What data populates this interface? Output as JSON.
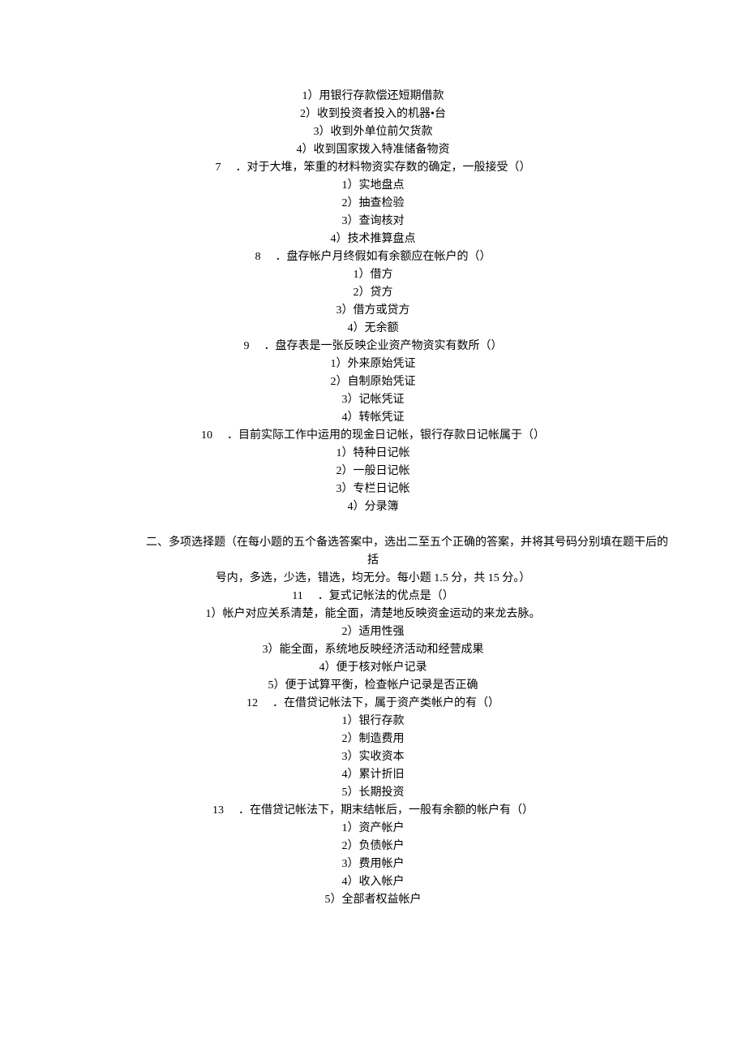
{
  "q6": {
    "options": [
      "1）用银行存款偿还短期借款",
      "2）收到投资者投入的机器•台",
      "3）收到外单位前欠货款",
      "4）收到国家拨入特准储备物资"
    ]
  },
  "q7": {
    "num": "7",
    "stem": "．对于大堆，笨重的材料物资实存数的确定，一般接受（）",
    "options": [
      "1）实地盘点",
      "2）抽查检验",
      "3）查询核对",
      "4）技术推算盘点"
    ]
  },
  "q8": {
    "num": "8",
    "stem": "．盘存帐户月终假如有余额应在帐户的（）",
    "options": [
      "1）借方",
      "2）贷方",
      "3）借方或贷方",
      "4）无余额"
    ]
  },
  "q9": {
    "num": "9",
    "stem": "．盘存表是一张反映企业资产物资实有数所（）",
    "options": [
      "1）外来原始凭证",
      "2）自制原始凭证",
      "3）记帐凭证",
      "4）转帐凭证"
    ]
  },
  "q10": {
    "num": "10",
    "stem": "．目前实际工作中运用的现金日记帐，银行存款日记帐属于（）",
    "options": [
      "1）特种日记帐",
      "2）一般日记帐",
      "3）专栏日记帐",
      "4）分录簿"
    ]
  },
  "section2": {
    "title_line1": "二、多项选择题（在每小题的五个备选答案中，选出二至五个正确的答案，并将其号码分别填在题干后的",
    "title_line2": "括",
    "instruction": "号内，多选，少选，错选，均无分。每小题 1.5 分，共 15 分。）"
  },
  "q11": {
    "num": "11",
    "stem": "．复式记帐法的优点是（）",
    "options": [
      "1）帐户对应关系清楚，能全面，清楚地反映资金运动的来龙去脉。",
      "2）适用性强",
      "3）能全面，系统地反映经济活动和经营成果",
      "4）便于核对帐户记录",
      "5）便于试算平衡，检查帐户记录是否正确"
    ]
  },
  "q12": {
    "num": "12",
    "stem": "．在借贷记帐法下，属于资产类帐户的有（）",
    "options": [
      "1）银行存款",
      "2）制造费用",
      "3）实收资本",
      "4）累计折旧",
      "5）长期投资"
    ]
  },
  "q13": {
    "num": "13",
    "stem": "．在借贷记帐法下，期末结帐后，一般有余额的帐户有（）",
    "options": [
      "1）资产帐户",
      "2）负债帐户",
      "3）费用帐户",
      "4）收入帐户",
      "5）全部者权益帐户"
    ]
  }
}
